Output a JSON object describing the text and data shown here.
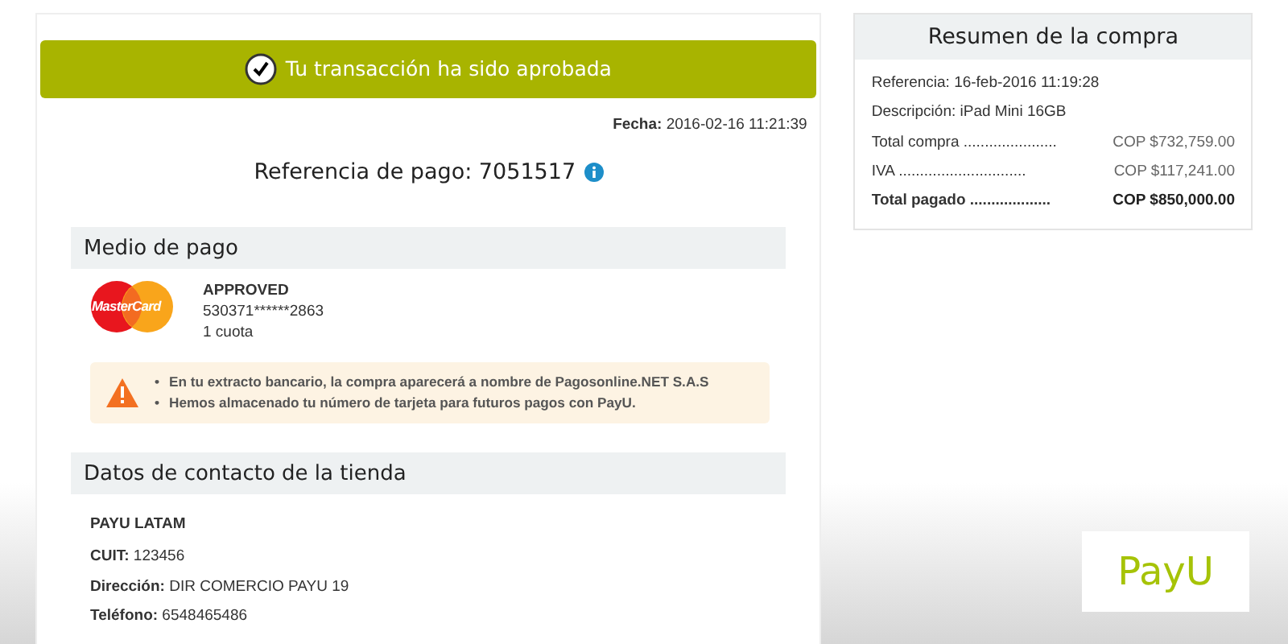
{
  "banner": {
    "text": "Tu transacción ha sido aprobada"
  },
  "date": {
    "label": "Fecha:",
    "value": "2016-02-16  11:21:39"
  },
  "reference": {
    "text": "Referencia de pago: 7051517"
  },
  "payment_method": {
    "title": "Medio de pago",
    "status": "APPROVED",
    "card_number": "530371******2863",
    "installments": "1 cuota",
    "card_brand": "MasterCard",
    "notices": [
      {
        "bullet": "•",
        "text": "En tu extracto bancario, la compra aparecerá a nombre de Pagosonline.NET S.A.S"
      },
      {
        "bullet": "•",
        "text": "Hemos almacenado tu número de tarjeta para futuros pagos con PayU."
      }
    ]
  },
  "store_contact": {
    "title": "Datos de contacto de la tienda",
    "name": "PAYU LATAM",
    "fields": [
      {
        "label": "CUIT:",
        "value": "123456"
      },
      {
        "label": "Dirección:",
        "value": "DIR COMERCIO PAYU 19"
      },
      {
        "label": "Teléfono:",
        "value": "6548465486"
      }
    ]
  },
  "summary": {
    "title": "Resumen de la compra",
    "info": [
      "Referencia: 16-feb-2016 11:19:28",
      "Descripción: iPad Mini 16GB"
    ],
    "lines": [
      {
        "label": "Total compra",
        "dots": "......................",
        "amount": "COP $732,759.00",
        "bold": false
      },
      {
        "label": "IVA",
        "dots": "..............................",
        "amount": "COP $117,241.00",
        "bold": false
      },
      {
        "label": "Total pagado",
        "dots": "...................",
        "amount": "COP $850,000.00",
        "bold": true
      }
    ]
  },
  "logo": {
    "text": "PayU"
  }
}
